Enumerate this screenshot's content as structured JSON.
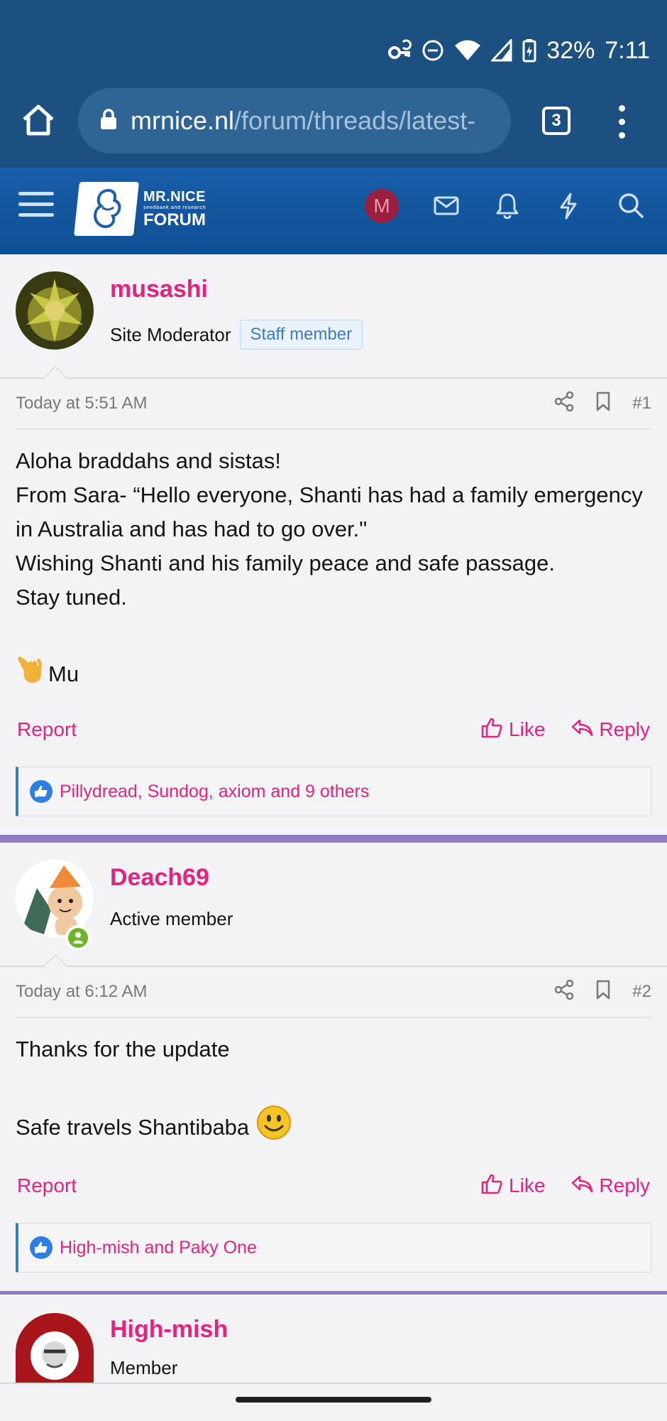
{
  "status_bar": {
    "battery": "32%",
    "time": "7:11",
    "icons": [
      "vpn-key-icon",
      "dnd-icon",
      "wifi-icon",
      "signal-icon",
      "battery-icon"
    ]
  },
  "browser": {
    "url_host": "mrnice.nl",
    "url_path": "/forum/threads/latest-",
    "tab_count": "3"
  },
  "forum_header": {
    "logo_top": "MR.NICE",
    "logo_tag": "seedbank and research",
    "logo_bottom": "FORUM",
    "avatar_letter": "M"
  },
  "posts": [
    {
      "username": "musashi",
      "user_title": "Site Moderator",
      "badge": "Staff member",
      "timestamp": "Today at 5:51 AM",
      "number": "#1",
      "lines": [
        "Aloha braddahs and sistas!",
        "From Sara- “Hello everyone, Shanti has had a family emergency in Australia and has had to go over.\"",
        "Wishing Shanti and his family peace and safe passage.",
        "Stay tuned."
      ],
      "signoff": "Mu",
      "reactions": "Pillydread, Sundog, axiom and 9 others"
    },
    {
      "username": "Deach69",
      "user_title": "Active member",
      "timestamp": "Today at 6:12 AM",
      "number": "#2",
      "line1": "Thanks for the update",
      "line2": "Safe travels Shantibaba",
      "reactions": "High-mish and Paky One"
    },
    {
      "username": "High-mish",
      "user_title": "Member"
    }
  ],
  "actions": {
    "report": "Report",
    "like": "Like",
    "reply": "Reply"
  },
  "colors": {
    "brand_pink": "#e3237d",
    "header_blue": "#185ea8",
    "browser_blue": "#1b5080",
    "separator": "#8d7dbf"
  }
}
